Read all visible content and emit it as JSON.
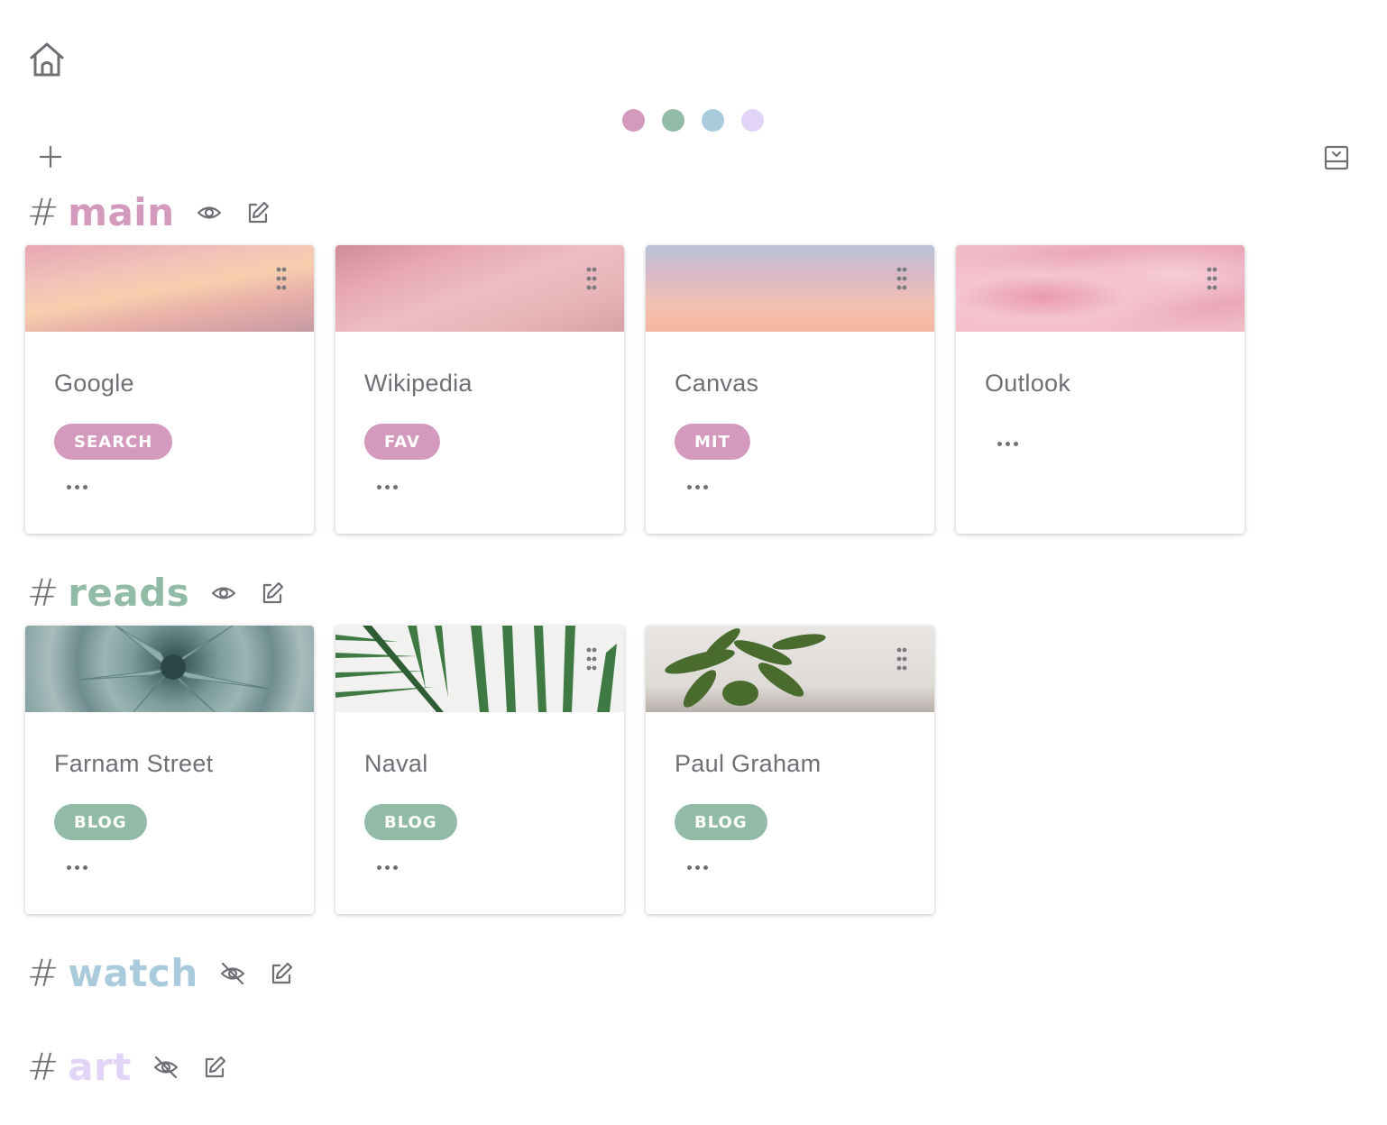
{
  "colors": {
    "main": "#d49abd",
    "reads": "#92bba7",
    "watch": "#a9cbdb",
    "art": "#e1d4f6",
    "text": "#6f7076"
  },
  "icons": {
    "home": "home-icon",
    "add": "plus-icon",
    "collapse": "collapse-all-icon",
    "visible": "eye-icon",
    "hidden": "eye-off-icon",
    "edit": "pencil-square-icon",
    "drag": "drag-handle-icon",
    "more": "ellipsis-icon"
  },
  "theme_dots": [
    {
      "name": "main",
      "color": "#d49abd"
    },
    {
      "name": "reads",
      "color": "#92bba7"
    },
    {
      "name": "watch",
      "color": "#a9cbdb"
    },
    {
      "name": "art",
      "color": "#e1d4f6"
    }
  ],
  "sections": [
    {
      "hash": "#",
      "name": "main",
      "visible": true,
      "cards": [
        {
          "title": "Google",
          "tag": "SEARCH",
          "image": "pink sunset clouds"
        },
        {
          "title": "Wikipedia",
          "tag": "FAV",
          "image": "pink streaked sky"
        },
        {
          "title": "Canvas",
          "tag": "MIT",
          "image": "peach sky gradient"
        },
        {
          "title": "Outlook",
          "tag": "",
          "image": "pink marble texture"
        }
      ]
    },
    {
      "hash": "#",
      "name": "reads",
      "visible": true,
      "cards": [
        {
          "title": "Farnam Street",
          "tag": "BLOG",
          "image": "succulent plant"
        },
        {
          "title": "Naval",
          "tag": "BLOG",
          "image": "palm leaves"
        },
        {
          "title": "Paul Graham",
          "tag": "BLOG",
          "image": "potted plant"
        }
      ]
    },
    {
      "hash": "#",
      "name": "watch",
      "visible": false,
      "cards": []
    },
    {
      "hash": "#",
      "name": "art",
      "visible": false,
      "cards": []
    }
  ]
}
